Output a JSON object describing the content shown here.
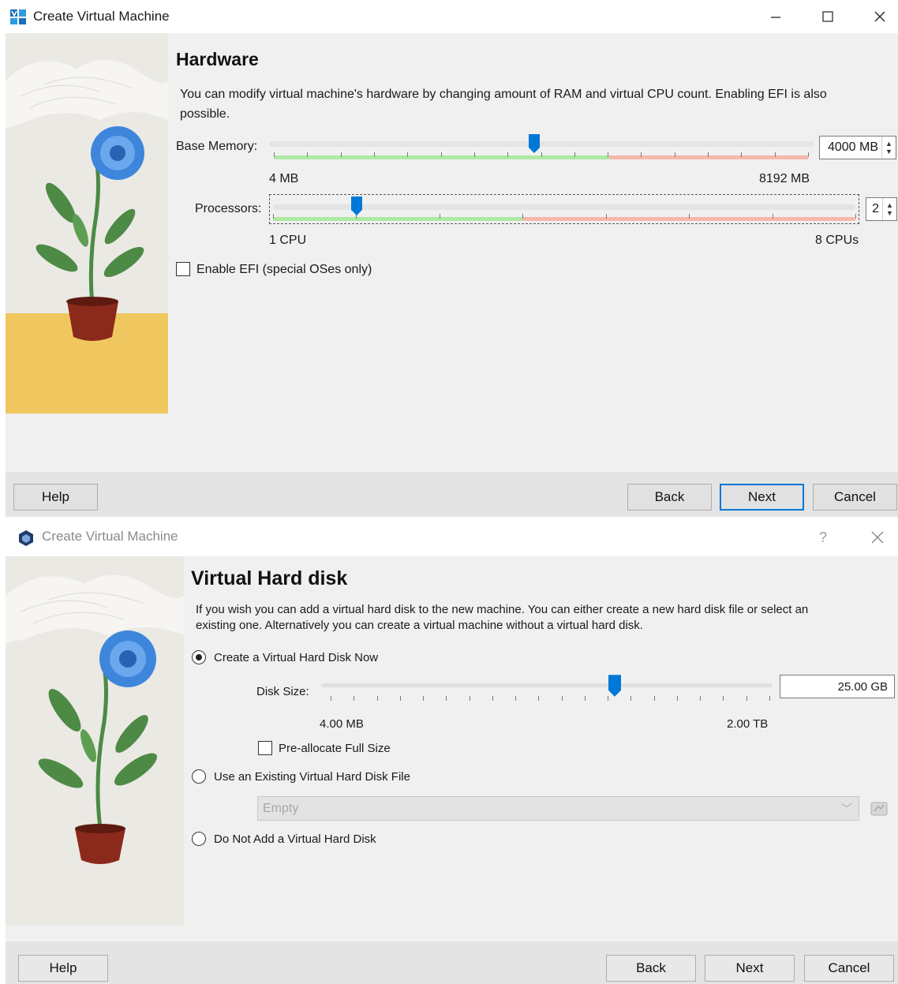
{
  "window1": {
    "title": "Create Virtual Machine",
    "heading": "Hardware",
    "description": "You can modify virtual machine's hardware by changing amount of RAM and virtual CPU count. Enabling EFI is also possible.",
    "base_memory": {
      "label": "Base Memory:",
      "min_label": "4 MB",
      "max_label": "8192 MB",
      "value": "4000 MB",
      "level": 0.488
    },
    "processors": {
      "label": "Processors:",
      "min_label": "1 CPU",
      "max_label": "8 CPUs",
      "value": "2",
      "level": 0.143
    },
    "efi_checkbox": {
      "label": "Enable EFI (special OSes only)",
      "checked": false
    },
    "buttons": {
      "help": "Help",
      "back": "Back",
      "next": "Next",
      "cancel": "Cancel"
    }
  },
  "window2": {
    "title": "Create Virtual Machine",
    "title_help": "?",
    "heading": "Virtual Hard disk",
    "description": "If you wish you can add a virtual hard disk to the new machine. You can either create a new hard disk file or select an existing one. Alternatively you can create a virtual machine without a virtual hard disk.",
    "options": {
      "create_now": "Create a Virtual Hard Disk Now",
      "use_existing": "Use an Existing Virtual Hard Disk File",
      "do_not_add": "Do Not Add a Virtual Hard Disk"
    },
    "selected_option": "create_now",
    "disk_size": {
      "label": "Disk Size:",
      "value": "25.00 GB",
      "min_label": "4.00 MB",
      "max_label": "2.00 TB",
      "level": 0.65
    },
    "preallocate": {
      "label": "Pre-allocate Full Size",
      "checked": false
    },
    "existing_file_combo": {
      "value": "Empty"
    },
    "buttons": {
      "help": "Help",
      "back": "Back",
      "next": "Next",
      "cancel": "Cancel"
    }
  },
  "colors": {
    "accent": "#0078d7",
    "green_zone": "#aee8a4",
    "red_zone": "#f5b8ab",
    "yellow_floor": "#efc75e",
    "flower_blue": "#3d86db",
    "pot": "#8b2a1c"
  }
}
